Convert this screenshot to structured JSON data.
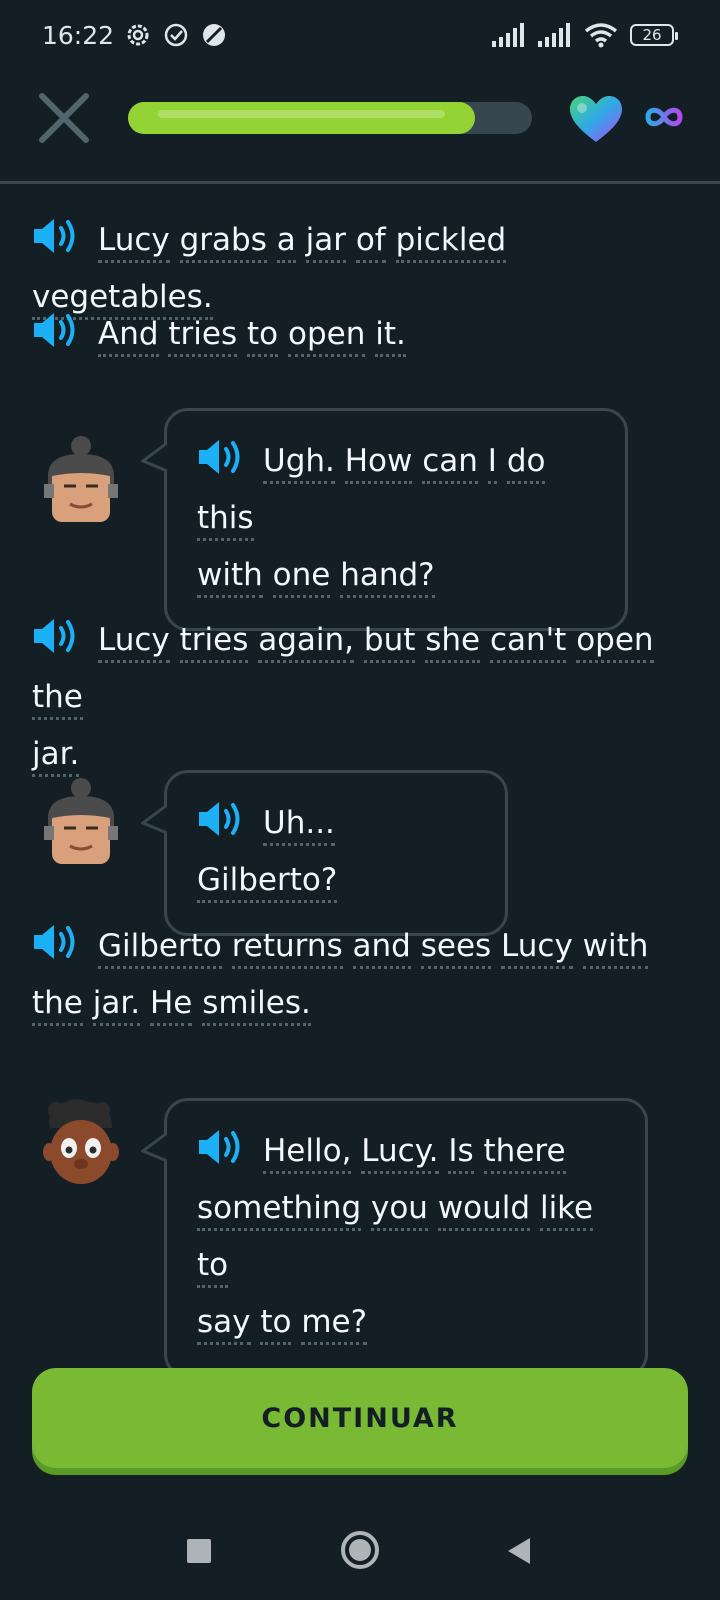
{
  "status_bar": {
    "time": "16:22",
    "battery": "26",
    "icons": [
      "gear-sync-icon",
      "check-circle-icon",
      "no-disturb-icon",
      "signal-icon",
      "signal-icon",
      "wifi-icon",
      "battery-icon"
    ]
  },
  "header": {
    "progress_percent": 86,
    "close_icon": "close-icon",
    "hearts_icon": "heart-icon",
    "hearts_value_icon": "infinity-icon"
  },
  "story": {
    "line1": {
      "words": [
        "Lucy",
        "grabs",
        "a",
        "jar",
        "of",
        "pickled",
        "vegetables."
      ]
    },
    "line2": {
      "words": [
        "And",
        "tries",
        "to",
        "open",
        "it."
      ]
    },
    "bubble1": {
      "speaker": "Lucy",
      "line_a": [
        "Ugh.",
        "How",
        "can",
        "I",
        "do",
        "this"
      ],
      "line_b": [
        "with",
        "one",
        "hand?"
      ]
    },
    "line3": {
      "line_a": [
        "Lucy",
        "tries",
        "again,",
        "but",
        "she",
        "can't",
        "open",
        "the"
      ],
      "line_b": [
        "jar."
      ]
    },
    "bubble2": {
      "speaker": "Lucy",
      "line_a": [
        "Uh...",
        "Gilberto?"
      ]
    },
    "line4": {
      "line_a": [
        "Gilberto",
        "returns",
        "and",
        "sees",
        "Lucy",
        "with"
      ],
      "line_b": [
        "the",
        "jar.",
        "He",
        "smiles."
      ]
    },
    "bubble3": {
      "speaker": "Gilberto",
      "line_a": [
        "Hello,",
        "Lucy.",
        "Is",
        "there"
      ],
      "line_b": [
        "something",
        "you",
        "would",
        "like",
        "to"
      ],
      "line_c": [
        "say",
        "to",
        "me?"
      ]
    }
  },
  "continue_button": {
    "label": "CONTINUAR"
  },
  "colors": {
    "background": "#131f24",
    "accent_green": "#79b933",
    "speaker_blue": "#1cb0f6",
    "border": "#37464f"
  }
}
